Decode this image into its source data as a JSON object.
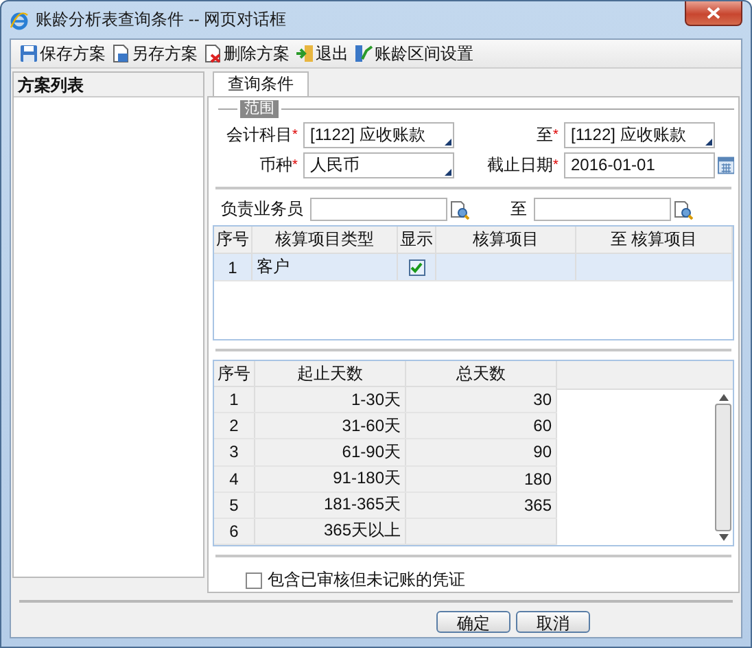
{
  "window": {
    "title": "账龄分析表查询条件 -- 网页对话框"
  },
  "toolbar": [
    {
      "kind": "save",
      "label": "保存方案"
    },
    {
      "kind": "save_as",
      "label": "另存方案"
    },
    {
      "kind": "delete",
      "label": "删除方案"
    },
    {
      "kind": "exit",
      "label": "退出"
    },
    {
      "kind": "settings",
      "label": "账龄区间设置"
    }
  ],
  "sidebar": {
    "title": "方案列表"
  },
  "tabs": [
    {
      "label": "查询条件",
      "selected": true
    }
  ],
  "range": {
    "legend": "范围",
    "fields": [
      {
        "label": "会计科目",
        "mark": "*",
        "value": "[1122] 应收账款",
        "kind": "dropdown"
      },
      {
        "label": "至",
        "mark": "*",
        "value": "[1122] 应收账款",
        "kind": "dropdown"
      },
      {
        "label": "币种",
        "mark": "*",
        "value": "人民币",
        "kind": "dropdown"
      },
      {
        "label": "截止日期",
        "mark": "*",
        "value": "2016-01-01",
        "kind": "date"
      }
    ]
  },
  "salesperson": [
    {
      "label": "负责业务员"
    },
    {
      "label": "至"
    }
  ],
  "items_table": {
    "columns": [
      "序号",
      "核算项目类型",
      "显示",
      "核算项目",
      "至 核算项目"
    ],
    "rows": [
      {
        "no": "1",
        "type": "客户",
        "show": true,
        "item": "",
        "to_item": "",
        "selected": true
      }
    ]
  },
  "aging_table": {
    "columns": [
      "序号",
      "起止天数",
      "总天数"
    ],
    "rows": [
      {
        "no": "1",
        "range": "1-30天",
        "total": "30"
      },
      {
        "no": "2",
        "range": "31-60天",
        "total": "60"
      },
      {
        "no": "3",
        "range": "61-90天",
        "total": "90"
      },
      {
        "no": "4",
        "range": "91-180天",
        "total": "180"
      },
      {
        "no": "5",
        "range": "181-365天",
        "total": "365"
      },
      {
        "no": "6",
        "range": "365天以上",
        "total": ""
      }
    ]
  },
  "option": {
    "label": "包含已审核但未记账的凭证",
    "checked": false
  },
  "buttons": [
    "确定",
    "取消"
  ]
}
